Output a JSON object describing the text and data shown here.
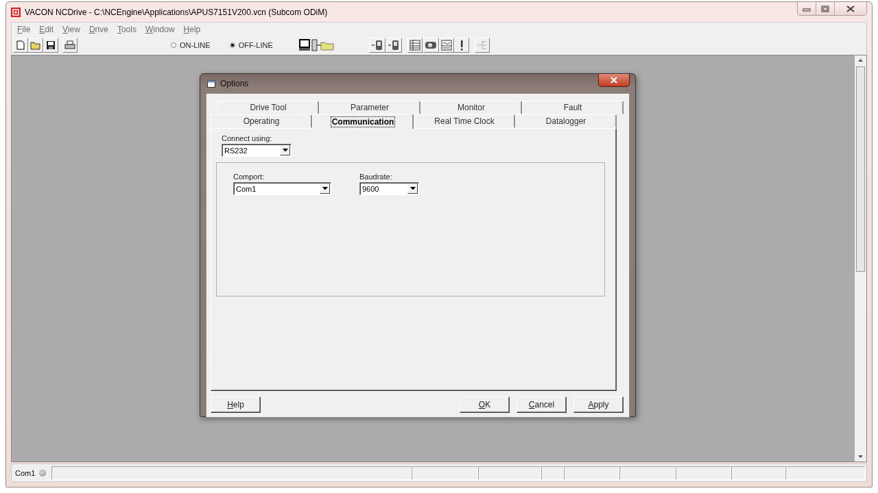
{
  "window": {
    "title": "VACON NCDrive - C:\\NCEngine\\Applications\\APUS7151V200.vcn (Subcom ODiM)"
  },
  "menu": [
    "File",
    "Edit",
    "View",
    "Drive",
    "Tools",
    "Window",
    "Help"
  ],
  "toolbar": {
    "modes": [
      {
        "label": "ON-LINE",
        "selected": false
      },
      {
        "label": "OFF-LINE",
        "selected": true
      }
    ]
  },
  "dialog": {
    "title": "Options",
    "tab_rows": [
      [
        {
          "label": "Drive Tool",
          "selected": false
        },
        {
          "label": "Parameter",
          "selected": false
        },
        {
          "label": "Monitor",
          "selected": false
        },
        {
          "label": "Fault",
          "selected": false
        }
      ],
      [
        {
          "label": "Operating",
          "selected": false
        },
        {
          "label": "Communication",
          "selected": true
        },
        {
          "label": "Real Time Clock",
          "selected": false
        },
        {
          "label": "Datalogger",
          "selected": false
        }
      ]
    ],
    "connect_label": "Connect using:",
    "connect_value": "RS232",
    "fields": [
      {
        "label": "Comport:",
        "value": "Com1"
      },
      {
        "label": "Baudrate:",
        "value": "9600"
      }
    ],
    "buttons": [
      "Help",
      "OK",
      "Cancel",
      "Apply"
    ]
  },
  "status_bar": {
    "port": "Com1"
  }
}
